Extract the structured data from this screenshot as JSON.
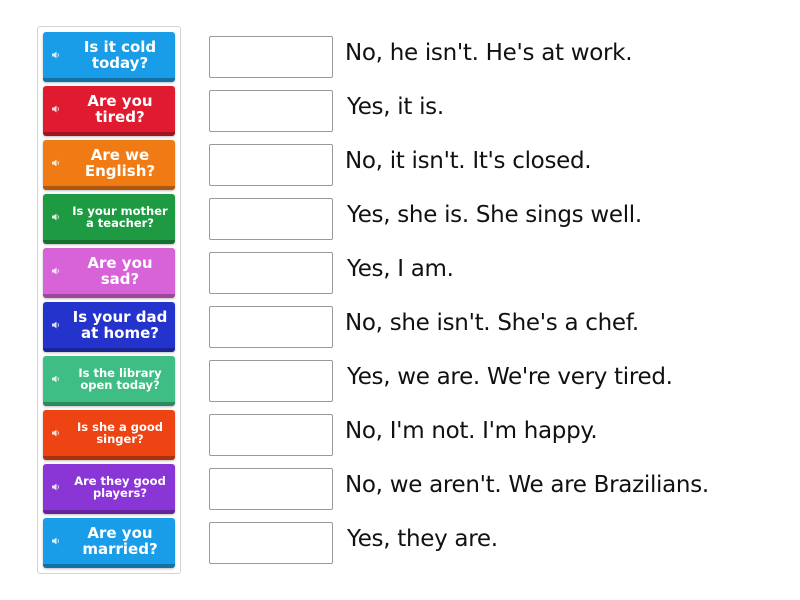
{
  "cards": [
    {
      "label": "Is it cold today?",
      "color": "#1a9de8",
      "size": "big"
    },
    {
      "label": "Are you tired?",
      "color": "#e01b2f",
      "size": "big"
    },
    {
      "label": "Are we English?",
      "color": "#f07b14",
      "size": "big"
    },
    {
      "label": "Is your mother a teacher?",
      "color": "#1e9a43",
      "size": "small"
    },
    {
      "label": "Are you sad?",
      "color": "#d863d8",
      "size": "big"
    },
    {
      "label": "Is your dad at home?",
      "color": "#2433cc",
      "size": "big"
    },
    {
      "label": "Is the library open today?",
      "color": "#3ebd84",
      "size": "small"
    },
    {
      "label": "Is she a good singer?",
      "color": "#ee4312",
      "size": "small"
    },
    {
      "label": "Are they good players?",
      "color": "#8a35d6",
      "size": "small"
    },
    {
      "label": "Are you married?",
      "color": "#1a9de8",
      "size": "big"
    }
  ],
  "answers": [
    "No, he isn't. He's at work.",
    "Yes, it is.",
    "No, it isn't. It's closed.",
    "Yes, she is. She sings well.",
    "Yes, I am.",
    "No, she isn't. She's a chef.",
    "Yes, we are. We're very tired.",
    "No, I'm not. I'm happy.",
    "No, we aren't. We are Brazilians.",
    "Yes, they are."
  ],
  "icons": {
    "card": "speaker-icon"
  }
}
